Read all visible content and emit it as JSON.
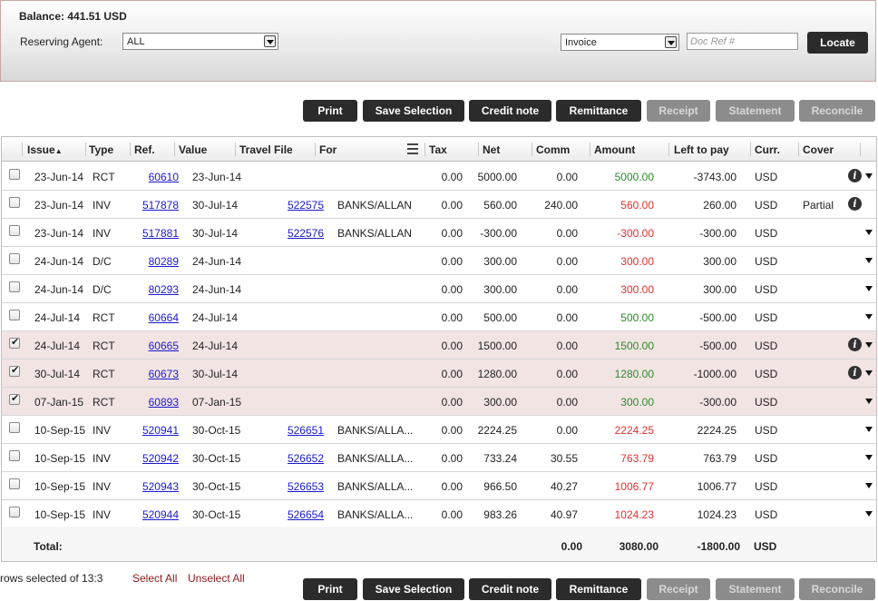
{
  "balance_label": "Balance: 441.51 USD",
  "agent": {
    "label": "Reserving Agent:",
    "value": "ALL"
  },
  "doc_type": {
    "value": "Invoice"
  },
  "doc_ref": {
    "placeholder": "Doc Ref #",
    "value": ""
  },
  "locate_label": "Locate",
  "toolbar": {
    "print": "Print",
    "save_selection": "Save Selection",
    "credit_note": "Credit note",
    "remittance": "Remittance",
    "receipt": "Receipt",
    "statement": "Statement",
    "reconcile": "Reconcile"
  },
  "columns": {
    "issue": "Issue",
    "type": "Type",
    "ref": "Ref.",
    "value": "Value",
    "travel_file": "Travel File",
    "for": "For",
    "tax": "Tax",
    "net": "Net",
    "comm": "Comm",
    "amount": "Amount",
    "left_to_pay": "Left to pay",
    "curr": "Curr.",
    "cover": "Cover"
  },
  "sort_indicator": "▲",
  "rows": [
    {
      "checked": false,
      "issue": "23-Jun-14",
      "type": "RCT",
      "ref": "60610",
      "value": "23-Jun-14",
      "travel_file": "",
      "for": "",
      "tax": "0.00",
      "net": "5000.00",
      "comm": "0.00",
      "amount": "5000.00",
      "amount_color": "green",
      "left": "-3743.00",
      "curr": "USD",
      "cover": "",
      "info": true,
      "caret": true
    },
    {
      "checked": false,
      "issue": "23-Jun-14",
      "type": "INV",
      "ref": "517878",
      "value": "30-Jul-14",
      "travel_file": "522575",
      "for": "BANKS/ALLAN",
      "tax": "0.00",
      "net": "560.00",
      "comm": "240.00",
      "amount": "560.00",
      "amount_color": "red",
      "left": "260.00",
      "curr": "USD",
      "cover": "Partial",
      "info": true,
      "caret": false
    },
    {
      "checked": false,
      "issue": "23-Jun-14",
      "type": "INV",
      "ref": "517881",
      "value": "30-Jul-14",
      "travel_file": "522576",
      "for": "BANKS/ALLAN",
      "tax": "0.00",
      "net": "-300.00",
      "comm": "0.00",
      "amount": "-300.00",
      "amount_color": "red",
      "left": "-300.00",
      "curr": "USD",
      "cover": "",
      "info": false,
      "caret": true
    },
    {
      "checked": false,
      "issue": "24-Jun-14",
      "type": "D/C",
      "ref": "80289",
      "value": "24-Jun-14",
      "travel_file": "",
      "for": "",
      "tax": "0.00",
      "net": "300.00",
      "comm": "0.00",
      "amount": "300.00",
      "amount_color": "red",
      "left": "300.00",
      "curr": "USD",
      "cover": "",
      "info": false,
      "caret": true
    },
    {
      "checked": false,
      "issue": "24-Jun-14",
      "type": "D/C",
      "ref": "80293",
      "value": "24-Jun-14",
      "travel_file": "",
      "for": "",
      "tax": "0.00",
      "net": "300.00",
      "comm": "0.00",
      "amount": "300.00",
      "amount_color": "red",
      "left": "300.00",
      "curr": "USD",
      "cover": "",
      "info": false,
      "caret": true
    },
    {
      "checked": false,
      "issue": "24-Jul-14",
      "type": "RCT",
      "ref": "60664",
      "value": "24-Jul-14",
      "travel_file": "",
      "for": "",
      "tax": "0.00",
      "net": "500.00",
      "comm": "0.00",
      "amount": "500.00",
      "amount_color": "green",
      "left": "-500.00",
      "curr": "USD",
      "cover": "",
      "info": false,
      "caret": true
    },
    {
      "checked": true,
      "issue": "24-Jul-14",
      "type": "RCT",
      "ref": "60665",
      "value": "24-Jul-14",
      "travel_file": "",
      "for": "",
      "tax": "0.00",
      "net": "1500.00",
      "comm": "0.00",
      "amount": "1500.00",
      "amount_color": "green",
      "left": "-500.00",
      "curr": "USD",
      "cover": "",
      "info": true,
      "caret": true
    },
    {
      "checked": true,
      "issue": "30-Jul-14",
      "type": "RCT",
      "ref": "60673",
      "value": "30-Jul-14",
      "travel_file": "",
      "for": "",
      "tax": "0.00",
      "net": "1280.00",
      "comm": "0.00",
      "amount": "1280.00",
      "amount_color": "green",
      "left": "-1000.00",
      "curr": "USD",
      "cover": "",
      "info": true,
      "caret": true
    },
    {
      "checked": true,
      "issue": "07-Jan-15",
      "type": "RCT",
      "ref": "60893",
      "value": "07-Jan-15",
      "travel_file": "",
      "for": "",
      "tax": "0.00",
      "net": "300.00",
      "comm": "0.00",
      "amount": "300.00",
      "amount_color": "green",
      "left": "-300.00",
      "curr": "USD",
      "cover": "",
      "info": false,
      "caret": true
    },
    {
      "checked": false,
      "issue": "10-Sep-15",
      "type": "INV",
      "ref": "520941",
      "value": "30-Oct-15",
      "travel_file": "526651",
      "for": "BANKS/ALLA...",
      "tax": "0.00",
      "net": "2224.25",
      "comm": "0.00",
      "amount": "2224.25",
      "amount_color": "red",
      "left": "2224.25",
      "curr": "USD",
      "cover": "",
      "info": false,
      "caret": true
    },
    {
      "checked": false,
      "issue": "10-Sep-15",
      "type": "INV",
      "ref": "520942",
      "value": "30-Oct-15",
      "travel_file": "526652",
      "for": "BANKS/ALLA...",
      "tax": "0.00",
      "net": "733.24",
      "comm": "30.55",
      "amount": "763.79",
      "amount_color": "red",
      "left": "763.79",
      "curr": "USD",
      "cover": "",
      "info": false,
      "caret": true
    },
    {
      "checked": false,
      "issue": "10-Sep-15",
      "type": "INV",
      "ref": "520943",
      "value": "30-Oct-15",
      "travel_file": "526653",
      "for": "BANKS/ALLA...",
      "tax": "0.00",
      "net": "966.50",
      "comm": "40.27",
      "amount": "1006.77",
      "amount_color": "red",
      "left": "1006.77",
      "curr": "USD",
      "cover": "",
      "info": false,
      "caret": true
    },
    {
      "checked": false,
      "issue": "10-Sep-15",
      "type": "INV",
      "ref": "520944",
      "value": "30-Oct-15",
      "travel_file": "526654",
      "for": "BANKS/ALLA...",
      "tax": "0.00",
      "net": "983.26",
      "comm": "40.97",
      "amount": "1024.23",
      "amount_color": "red",
      "left": "1024.23",
      "curr": "USD",
      "cover": "",
      "info": false,
      "caret": true
    }
  ],
  "totals": {
    "label": "Total:",
    "comm": "0.00",
    "amount": "3080.00",
    "left": "-1800.00",
    "curr": "USD"
  },
  "footer": {
    "count_text": "rows selected of 13:3",
    "select_all": "Select All",
    "unselect_all": "Unselect All"
  },
  "colors": {
    "amount_green": "#2a8a2a",
    "amount_red": "#e03030",
    "selected_row": "#f3e4e4",
    "button": "#2b2b2b",
    "link": "#1a1acc"
  }
}
